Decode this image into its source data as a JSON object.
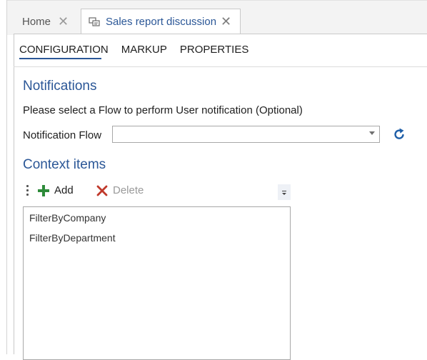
{
  "tabs": [
    {
      "label": "Home"
    },
    {
      "label": "Sales report discussion"
    }
  ],
  "subtabs": [
    {
      "label": "CONFIGURATION"
    },
    {
      "label": "MARKUP"
    },
    {
      "label": "PROPERTIES"
    }
  ],
  "notifications": {
    "title": "Notifications",
    "description": "Please select a Flow to perform User notification (Optional)",
    "flow_label": "Notification Flow",
    "flow_value": ""
  },
  "context_items": {
    "title": "Context items",
    "add_label": "Add",
    "delete_label": "Delete",
    "items": [
      "FilterByCompany",
      "FilterByDepartment"
    ]
  },
  "colors": {
    "accent": "#2b5797",
    "add_green": "#2e8b3a",
    "delete_red": "#c0392b"
  }
}
